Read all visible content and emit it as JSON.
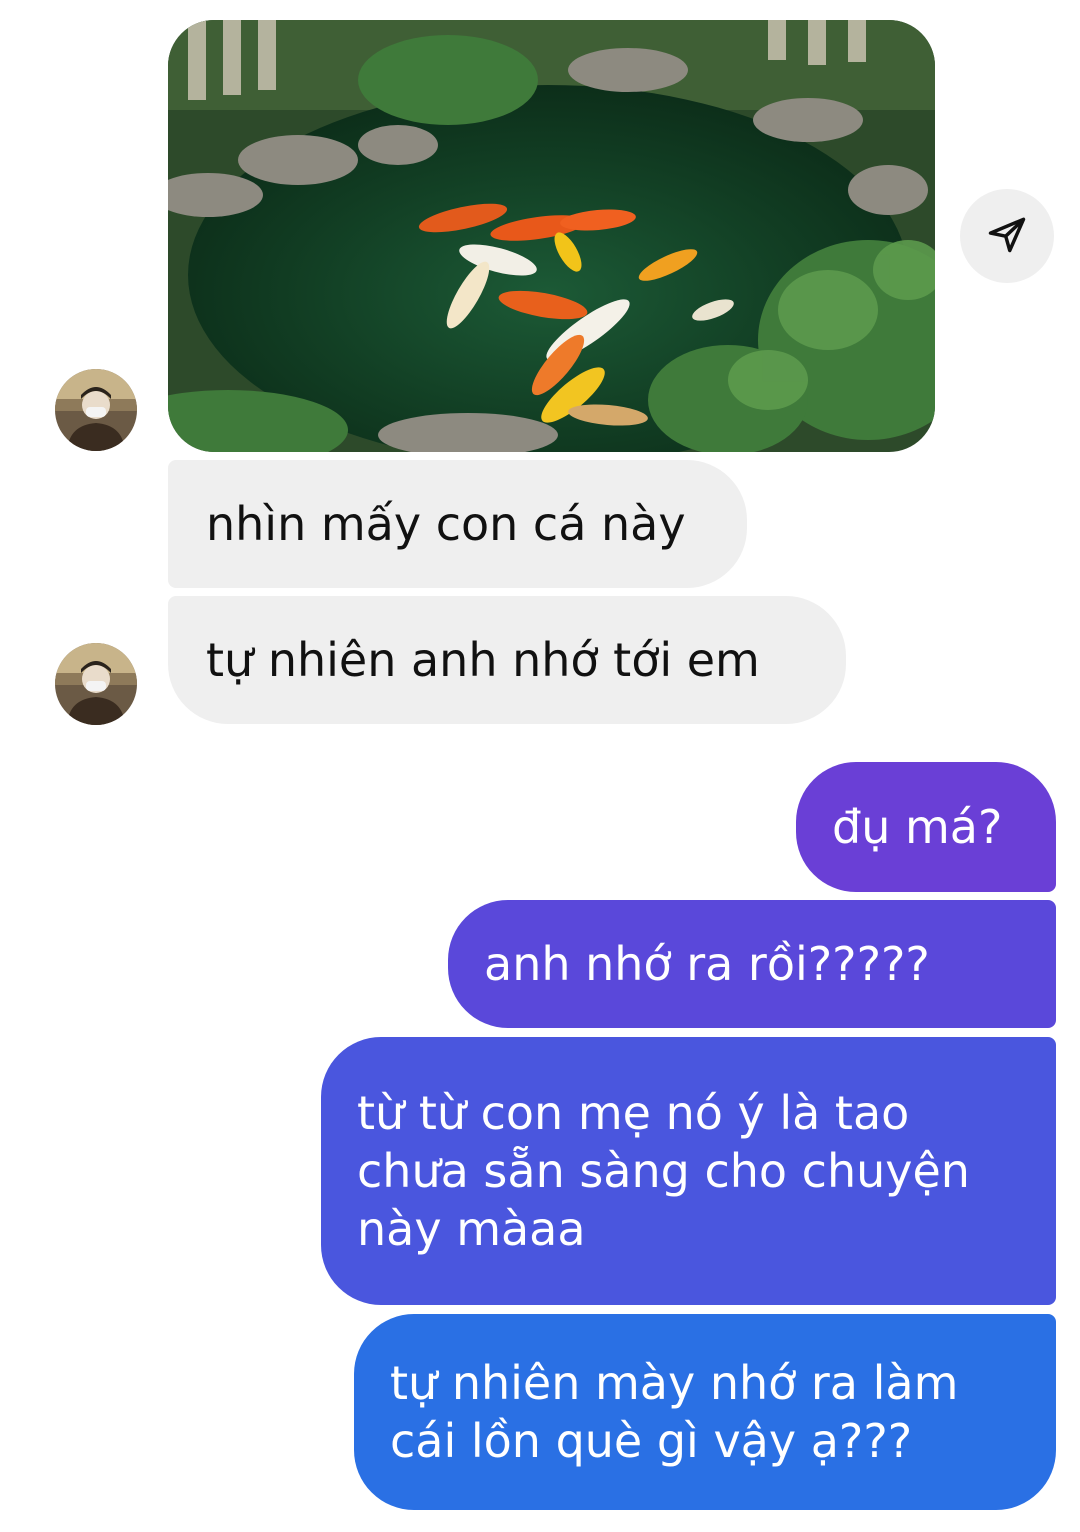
{
  "conversation": {
    "photo": {
      "subject": "koi-pond-photo"
    },
    "share_button": {
      "icon": "send-icon"
    },
    "avatar": {
      "icon": "contact-avatar"
    },
    "messages": [
      {
        "direction": "incoming",
        "text": "nhìn mấy con cá này"
      },
      {
        "direction": "incoming",
        "text": "tự nhiên anh nhớ tới em"
      },
      {
        "direction": "outgoing",
        "text": "đụ má?"
      },
      {
        "direction": "outgoing",
        "text": "anh nhớ ra rồi?????"
      },
      {
        "direction": "outgoing",
        "text": "từ từ con mẹ nó ý là tao\nchưa sẵn sàng cho chuyện\nnày màaa"
      },
      {
        "direction": "outgoing",
        "text": "tự nhiên mày nhớ ra làm\ncái lồn què gì vậy ạ???"
      }
    ]
  },
  "colors": {
    "incoming_bubble": "#efefef",
    "outgoing_top": "#6a3fd6",
    "outgoing_mid": "#4b52de",
    "outgoing_bottom": "#2a70e4"
  }
}
